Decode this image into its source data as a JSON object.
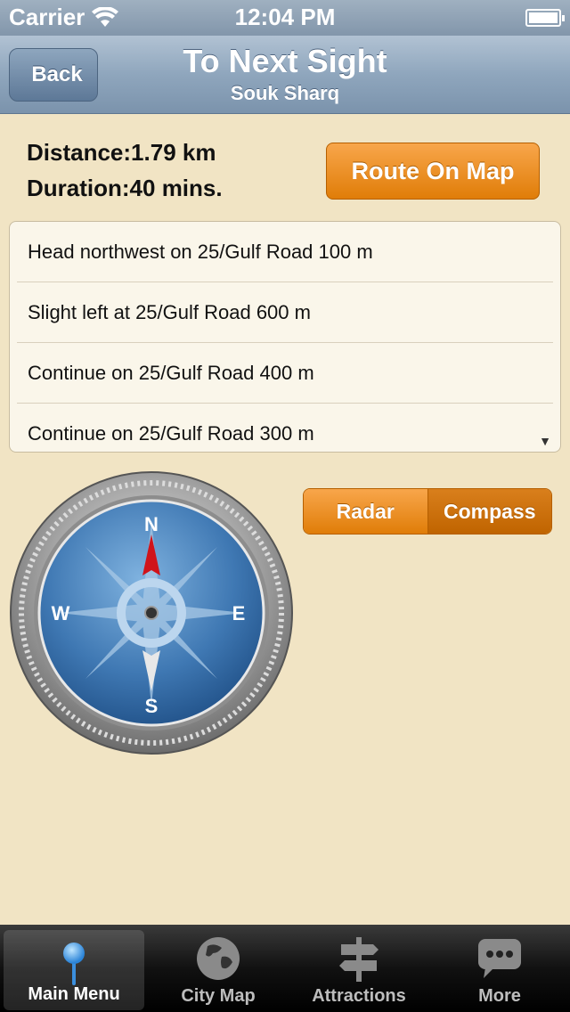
{
  "status": {
    "carrier": "Carrier",
    "time": "12:04 PM"
  },
  "nav": {
    "back_label": "Back",
    "title": "To Next Sight",
    "subtitle": "Souk Sharq"
  },
  "info": {
    "distance_label": "Distance:",
    "distance_value": "1.79 km",
    "duration_label": "Duration:",
    "duration_value": "40 mins.",
    "route_button": "Route On Map"
  },
  "directions": [
    "Head northwest on 25/Gulf Road 100 m",
    "Slight left at 25/Gulf Road 600 m",
    "Continue on 25/Gulf Road 400 m",
    "Continue on 25/Gulf Road 300 m"
  ],
  "mode_toggle": {
    "radar": "Radar",
    "compass": "Compass",
    "selected": "Compass"
  },
  "compass": {
    "n": "N",
    "e": "E",
    "s": "S",
    "w": "W",
    "needle_color": "#d0141b"
  },
  "tabs": [
    {
      "label": "Main Menu",
      "icon": "map-pin-icon",
      "selected": true
    },
    {
      "label": "City Map",
      "icon": "globe-icon",
      "selected": false
    },
    {
      "label": "Attractions",
      "icon": "signpost-icon",
      "selected": false
    },
    {
      "label": "More",
      "icon": "chat-bubble-icon",
      "selected": false
    }
  ],
  "colors": {
    "accent": "#e98b1f",
    "background": "#f1e4c4",
    "nav": "#8fa6bd"
  }
}
